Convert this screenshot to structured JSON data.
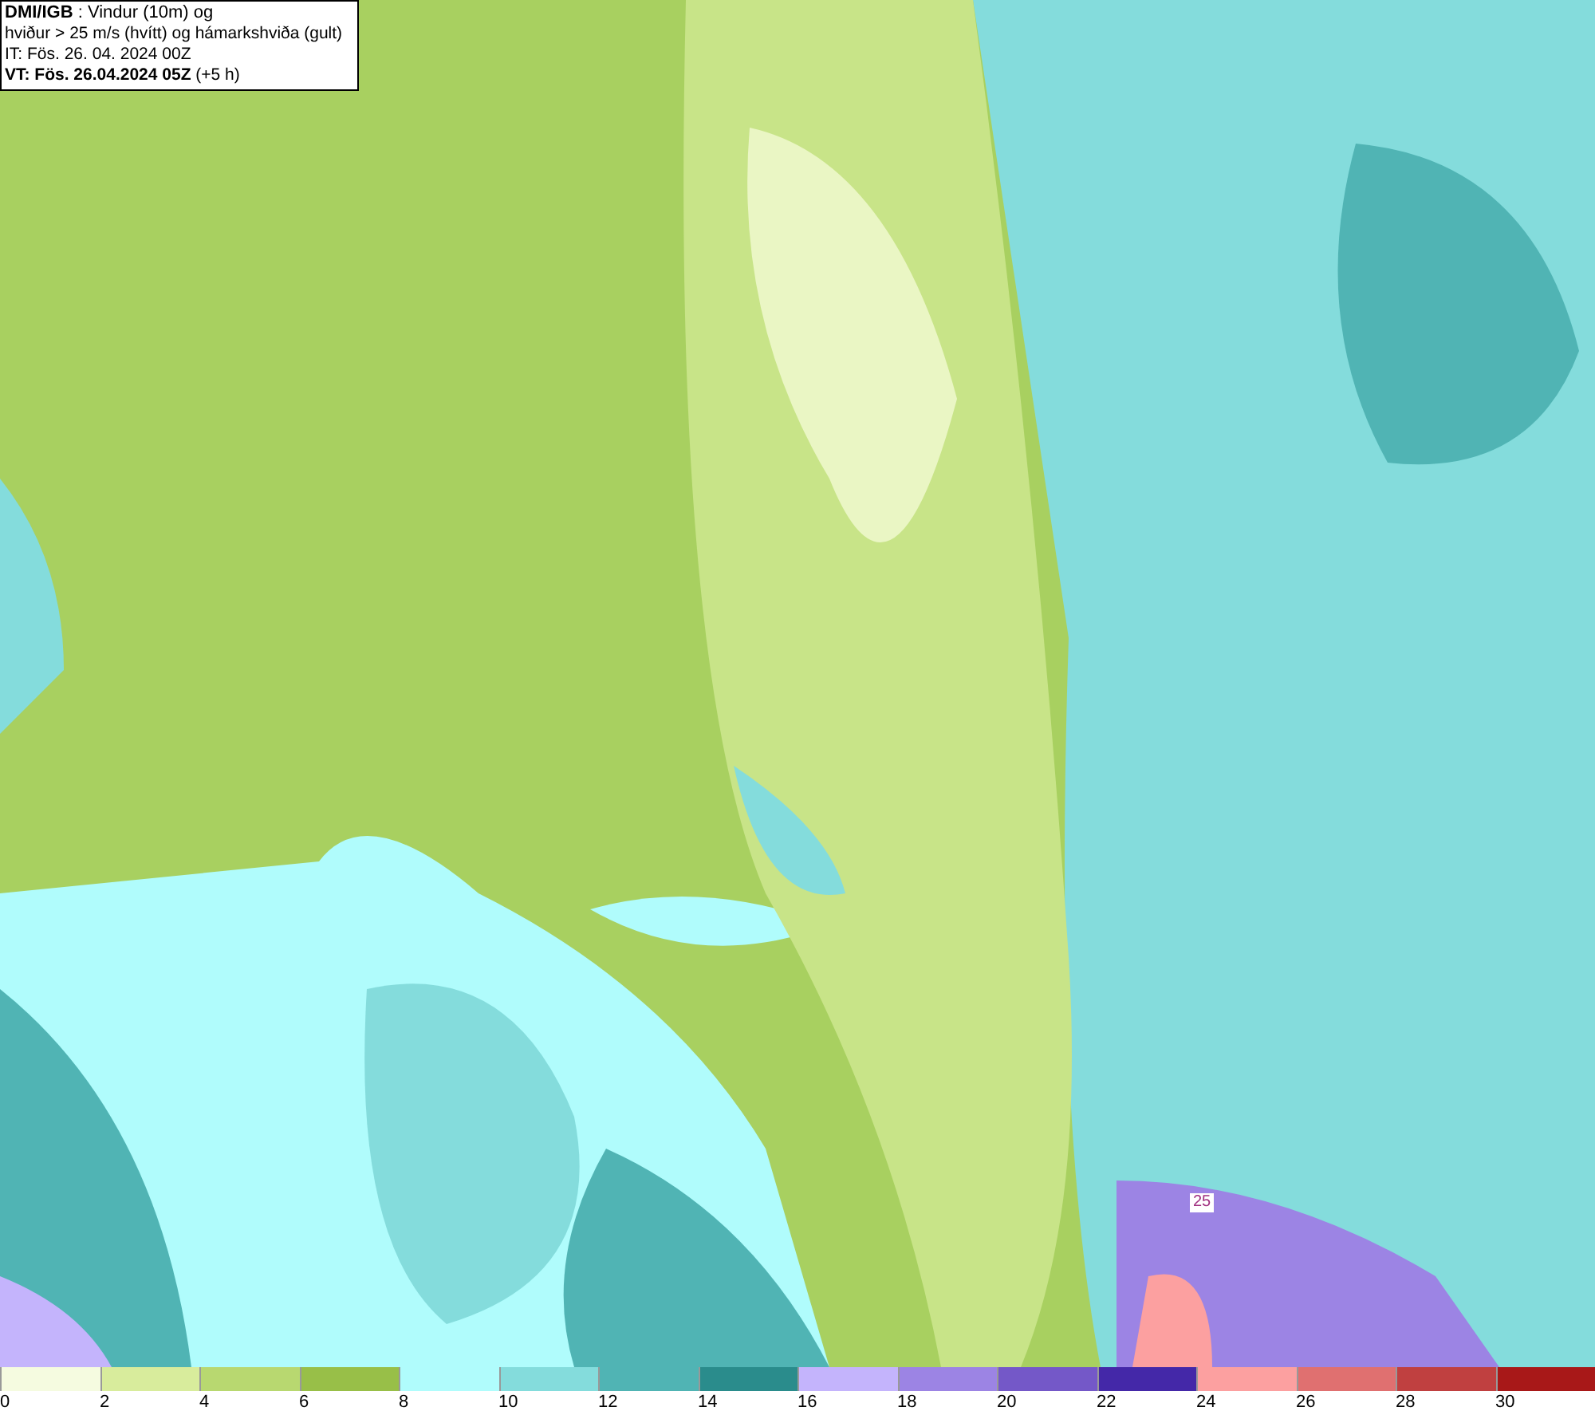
{
  "info_box": {
    "lines": [
      "**DMI/IGB** : Vindur (10m) og",
      "hviður > 25 m/s (hvítt) og hámarkshviða (gult)",
      "IT: Fös. 26. 04. 2024 00Z",
      "**VT: Fös. 26.04.2024 05Z** (+5 h)"
    ]
  },
  "map": {
    "contour_label": "25"
  },
  "legend": [
    {
      "label": "0",
      "color": "#f5fbe0"
    },
    {
      "label": "2",
      "color": "#d8ec9c"
    },
    {
      "label": "4",
      "color": "#b8d870"
    },
    {
      "label": "6",
      "color": "#98bf48"
    },
    {
      "label": "8",
      "color": "#b0fcfc"
    },
    {
      "label": "10",
      "color": "#84dcdc"
    },
    {
      "label": "12",
      "color": "#50b4b4"
    },
    {
      "label": "14",
      "color": "#2a8c8c"
    },
    {
      "label": "16",
      "color": "#c4b4fc"
    },
    {
      "label": "18",
      "color": "#9c84e4"
    },
    {
      "label": "20",
      "color": "#7458c8"
    },
    {
      "label": "22",
      "color": "#4428a8"
    },
    {
      "label": "24",
      "color": "#fca0a0"
    },
    {
      "label": "26",
      "color": "#e07070"
    },
    {
      "label": "28",
      "color": "#c04040"
    },
    {
      "label": "30",
      "color": "#a81818"
    }
  ]
}
